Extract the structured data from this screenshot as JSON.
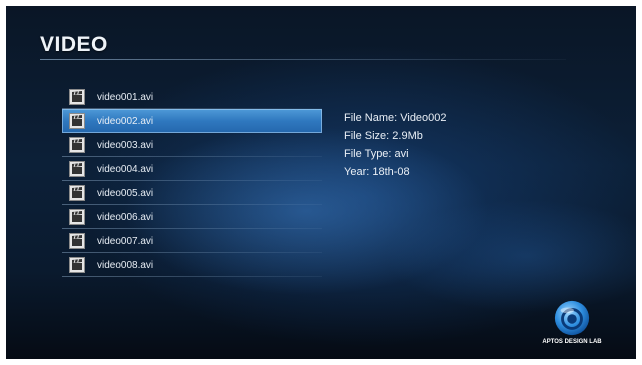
{
  "page": {
    "title": "VIDEO"
  },
  "files": [
    {
      "name": "video001.avi",
      "icon": "video-clapper-icon",
      "selected": false
    },
    {
      "name": "video002.avi",
      "icon": "video-clapper-icon",
      "selected": true
    },
    {
      "name": "video003.avi",
      "icon": "video-clapper-icon",
      "selected": false
    },
    {
      "name": "video004.avi",
      "icon": "video-clapper-icon",
      "selected": false
    },
    {
      "name": "video005.avi",
      "icon": "video-clapper-icon",
      "selected": false
    },
    {
      "name": "video006.avi",
      "icon": "video-clapper-icon",
      "selected": false
    },
    {
      "name": "video007.avi",
      "icon": "video-clapper-icon",
      "selected": false
    },
    {
      "name": "video008.avi",
      "icon": "video-clapper-icon",
      "selected": false
    }
  ],
  "info": {
    "file_name": "File Name: Video002",
    "file_size": "File Size: 2.9Mb",
    "file_type": "File Type: avi",
    "year": "Year: 18th-08"
  },
  "logo": {
    "text": "APTOS DESIGN LAB"
  },
  "colors": {
    "selection": "#2f78bf",
    "background": "#0c2038",
    "text": "#e8eef5"
  }
}
